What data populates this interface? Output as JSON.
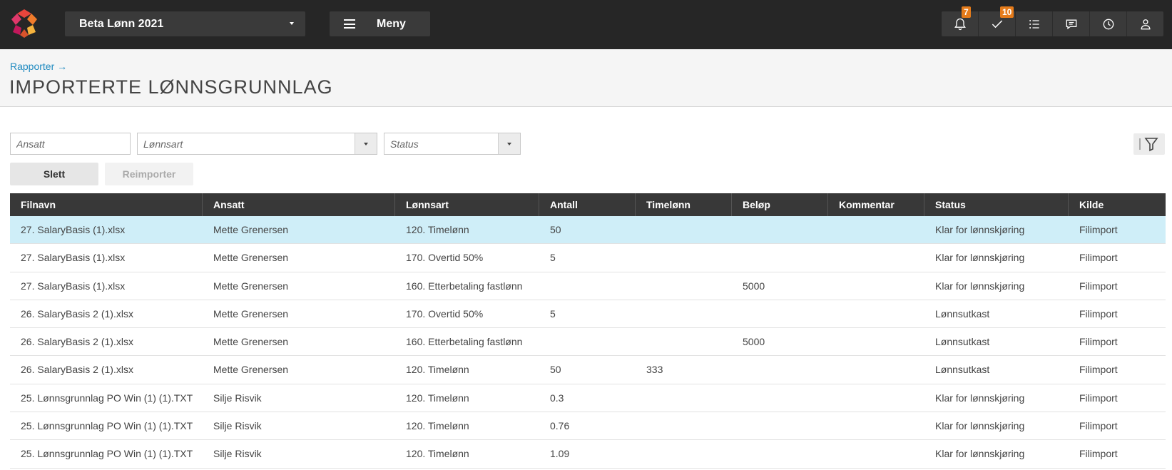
{
  "topbar": {
    "company": "Beta Lønn 2021",
    "menu_label": "Meny",
    "notifications_count": "7",
    "tasks_count": "10"
  },
  "breadcrumb": "Rapporter →",
  "page_title": "IMPORTERTE LØNNSGRUNNLAG",
  "filters": {
    "ansatt_placeholder": "Ansatt",
    "lonnsart_placeholder": "Lønnsart",
    "status_placeholder": "Status"
  },
  "buttons": {
    "slett": "Slett",
    "reimporter": "Reimporter"
  },
  "table": {
    "headers": [
      "Filnavn",
      "Ansatt",
      "Lønnsart",
      "Antall",
      "Timelønn",
      "Beløp",
      "Kommentar",
      "Status",
      "Kilde"
    ],
    "rows": [
      [
        "27. SalaryBasis (1).xlsx",
        "Mette Grenersen",
        "120. Timelønn",
        "50",
        "",
        "",
        "",
        "Klar for lønnskjøring",
        "Filimport"
      ],
      [
        "27. SalaryBasis (1).xlsx",
        "Mette Grenersen",
        "170. Overtid 50%",
        "5",
        "",
        "",
        "",
        "Klar for lønnskjøring",
        "Filimport"
      ],
      [
        "27. SalaryBasis (1).xlsx",
        "Mette Grenersen",
        "160. Etterbetaling fastlønn",
        "",
        "",
        "5000",
        "",
        "Klar for lønnskjøring",
        "Filimport"
      ],
      [
        "26. SalaryBasis 2 (1).xlsx",
        "Mette Grenersen",
        "170. Overtid 50%",
        "5",
        "",
        "",
        "",
        "Lønnsutkast",
        "Filimport"
      ],
      [
        "26. SalaryBasis 2 (1).xlsx",
        "Mette Grenersen",
        "160. Etterbetaling fastlønn",
        "",
        "",
        "5000",
        "",
        "Lønnsutkast",
        "Filimport"
      ],
      [
        "26. SalaryBasis 2 (1).xlsx",
        "Mette Grenersen",
        "120. Timelønn",
        "50",
        "333",
        "",
        "",
        "Lønnsutkast",
        "Filimport"
      ],
      [
        "25. Lønnsgrunnlag PO Win (1) (1).TXT",
        "Silje Risvik",
        "120. Timelønn",
        "0.3",
        "",
        "",
        "",
        "Klar for lønnskjøring",
        "Filimport"
      ],
      [
        "25. Lønnsgrunnlag PO Win (1) (1).TXT",
        "Silje Risvik",
        "120. Timelønn",
        "0.76",
        "",
        "",
        "",
        "Klar for lønnskjøring",
        "Filimport"
      ],
      [
        "25. Lønnsgrunnlag PO Win (1) (1).TXT",
        "Silje Risvik",
        "120. Timelønn",
        "1.09",
        "",
        "",
        "",
        "Klar for lønnskjøring",
        "Filimport"
      ]
    ]
  },
  "colors": {
    "topbar": "#262626",
    "accent_badge": "#e57b1a",
    "link": "#1f8ac0",
    "selected_row": "#cfeef8"
  }
}
